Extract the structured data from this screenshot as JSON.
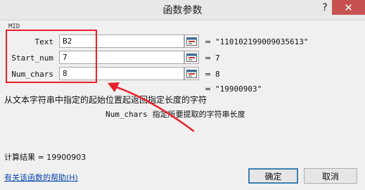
{
  "window": {
    "title": "函数参数",
    "help_glyph": "?",
    "close_glyph": "✕"
  },
  "group": {
    "label": "MID"
  },
  "args": [
    {
      "name": "Text",
      "value": "B2",
      "equals": "=",
      "result": "\"110102199009035613\""
    },
    {
      "name": "Start_num",
      "value": "7",
      "equals": "=",
      "result": "7"
    },
    {
      "name": "Num_chars",
      "value": "8",
      "equals": "=",
      "result": "8"
    }
  ],
  "formula_result": {
    "equals": "=",
    "value": "\"19900903\""
  },
  "description": "从文本字符串中指定的起始位置起返回指定长度的字符",
  "arg_help": {
    "name": "Num_chars",
    "text": "指定所要提取的字符串长度"
  },
  "calc_result": {
    "label": "计算结果",
    "equals": "=",
    "value": "19900903"
  },
  "help_link": "有关该函数的帮助(H)",
  "buttons": {
    "ok": "确定",
    "cancel": "取消"
  },
  "colors": {
    "annotation": "#e8202a",
    "close_button": "#c75050",
    "link": "#0645ad"
  },
  "icons": {
    "ref_button": "collapse-dialog-icon"
  }
}
